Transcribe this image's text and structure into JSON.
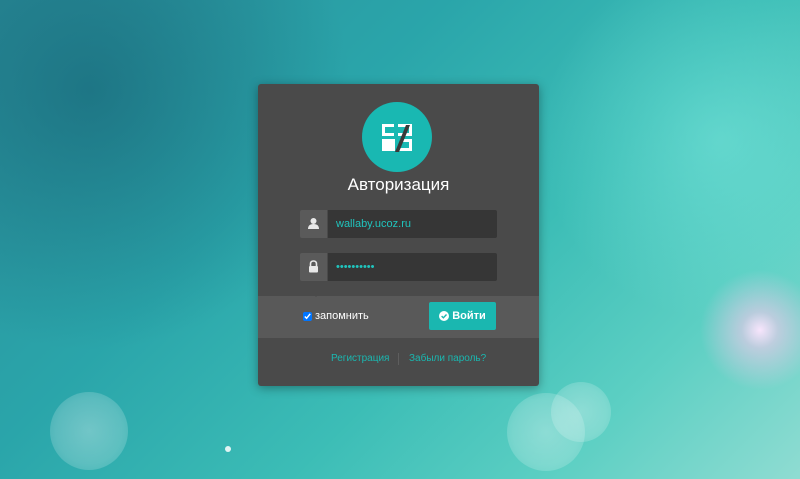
{
  "login": {
    "title": "Авторизация",
    "username_value": "wallaby.ucoz.ru",
    "password_value": "••••••••••",
    "remember_label": "запомнить",
    "remember_checked": true,
    "submit_label": "Войти",
    "register_link": "Регистрация",
    "forgot_link": "Забыли пароль?",
    "icons": {
      "logo": "ucoz-logo-icon",
      "user": "user-icon",
      "lock": "lock-icon",
      "submit": "check-circle-icon"
    }
  },
  "colors": {
    "accent": "#1ab7b0",
    "panel": "#4a4a4a",
    "band": "#595959",
    "input_bg": "#363636"
  }
}
